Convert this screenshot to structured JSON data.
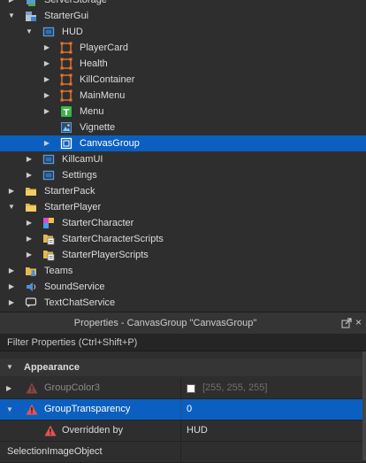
{
  "explorer": {
    "items": [
      {
        "label": "ServerStorage",
        "icon": "server-storage-icon"
      },
      {
        "label": "StarterGui",
        "icon": "starter-gui-icon"
      },
      {
        "label": "HUD",
        "icon": "screen-gui-icon"
      },
      {
        "label": "PlayerCard",
        "icon": "frame-icon"
      },
      {
        "label": "Health",
        "icon": "frame-icon"
      },
      {
        "label": "KillContainer",
        "icon": "frame-icon"
      },
      {
        "label": "MainMenu",
        "icon": "frame-icon"
      },
      {
        "label": "Menu",
        "icon": "text-label-icon"
      },
      {
        "label": "Vignette",
        "icon": "image-label-icon"
      },
      {
        "label": "CanvasGroup",
        "icon": "canvas-group-icon"
      },
      {
        "label": "KillcamUI",
        "icon": "screen-gui-icon"
      },
      {
        "label": "Settings",
        "icon": "screen-gui-icon"
      },
      {
        "label": "StarterPack",
        "icon": "folder-icon"
      },
      {
        "label": "StarterPlayer",
        "icon": "folder-icon"
      },
      {
        "label": "StarterCharacter",
        "icon": "model-icon"
      },
      {
        "label": "StarterCharacterScripts",
        "icon": "folder-script-icon"
      },
      {
        "label": "StarterPlayerScripts",
        "icon": "folder-script-icon"
      },
      {
        "label": "Teams",
        "icon": "teams-icon"
      },
      {
        "label": "SoundService",
        "icon": "sound-service-icon"
      },
      {
        "label": "TextChatService",
        "icon": "chat-icon"
      }
    ]
  },
  "properties": {
    "title": "Properties - CanvasGroup \"CanvasGroup\"",
    "filter_placeholder": "Filter Properties (Ctrl+Shift+P)",
    "section": "Appearance",
    "rows": [
      {
        "name": "GroupColor3",
        "value": "[255, 255, 255]"
      },
      {
        "name": "GroupTransparency",
        "value": "0"
      },
      {
        "name": "Overridden by",
        "value": "HUD"
      },
      {
        "name": "SelectionImageObject",
        "value": ""
      }
    ]
  },
  "colors": {
    "background": "#2e2e2e",
    "selection": "#0b5fc0",
    "frame_icon": "#e8762e",
    "warning": "#e05555"
  }
}
